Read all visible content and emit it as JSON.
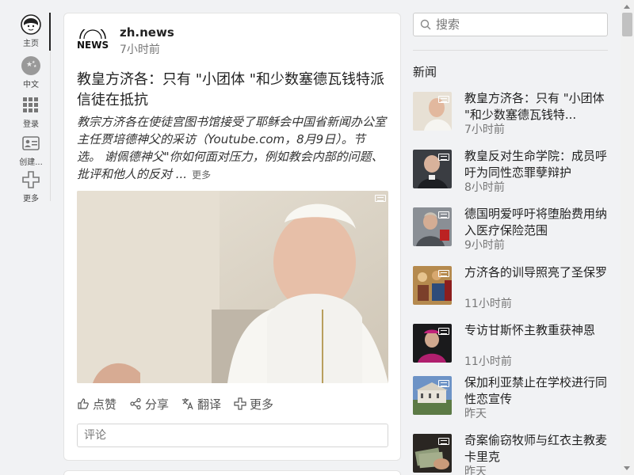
{
  "rail": {
    "items": [
      {
        "label": "主页",
        "icon": "home-avatar-icon"
      },
      {
        "label": "中文",
        "icon": "china-flag-icon"
      },
      {
        "label": "登录",
        "icon": "apps-grid-icon"
      },
      {
        "label": "创建...",
        "icon": "id-card-icon"
      },
      {
        "label": "更多",
        "icon": "plus-icon"
      }
    ]
  },
  "post": {
    "logo_text": "NEWS",
    "source": "zh.news",
    "time": "7小时前",
    "headline": "教皇方济各：只有 \"小团体 \"和少数塞德瓦钱特派信徒在抵抗",
    "summary": "教宗方济各在使徒宫图书馆接受了耶稣会中国省新闻办公室主任贾培德神父的采访（Youtube.com，8月9日）。节选。 谢佩德神父\"你如何面对压力，例如教会内部的问题、批评和他人的反对 ...",
    "more_label": "更多",
    "actions": {
      "like": "点赞",
      "share": "分享",
      "translate": "翻译",
      "more": "更多"
    },
    "comment_placeholder": "评论"
  },
  "search": {
    "placeholder": "搜索"
  },
  "news_section": {
    "title": "新闻",
    "items": [
      {
        "title": "教皇方济各：只有 \"小团体 \"和少数塞德瓦钱特...",
        "time": "7小时前"
      },
      {
        "title": "教皇反对生命学院：成员呼吁为同性恋罪孽辩护",
        "time": "8小时前"
      },
      {
        "title": "德国明爱呼吁将堕胎费用纳入医疗保险范围",
        "time": "9小时前"
      },
      {
        "title": "方济各的训导照亮了圣保罗",
        "time": "11小时前"
      },
      {
        "title": "专访甘斯怀主教重获神恩",
        "time": "11小时前"
      },
      {
        "title": "保加利亚禁止在学校进行同性恋宣传",
        "time": "昨天"
      },
      {
        "title": "奇案偷窃牧师与红衣主教麦卡里克",
        "time": "昨天"
      }
    ]
  },
  "colors": {
    "background": "#f1f2f4",
    "card": "#ffffff",
    "text": "#222222",
    "muted": "#777777"
  }
}
